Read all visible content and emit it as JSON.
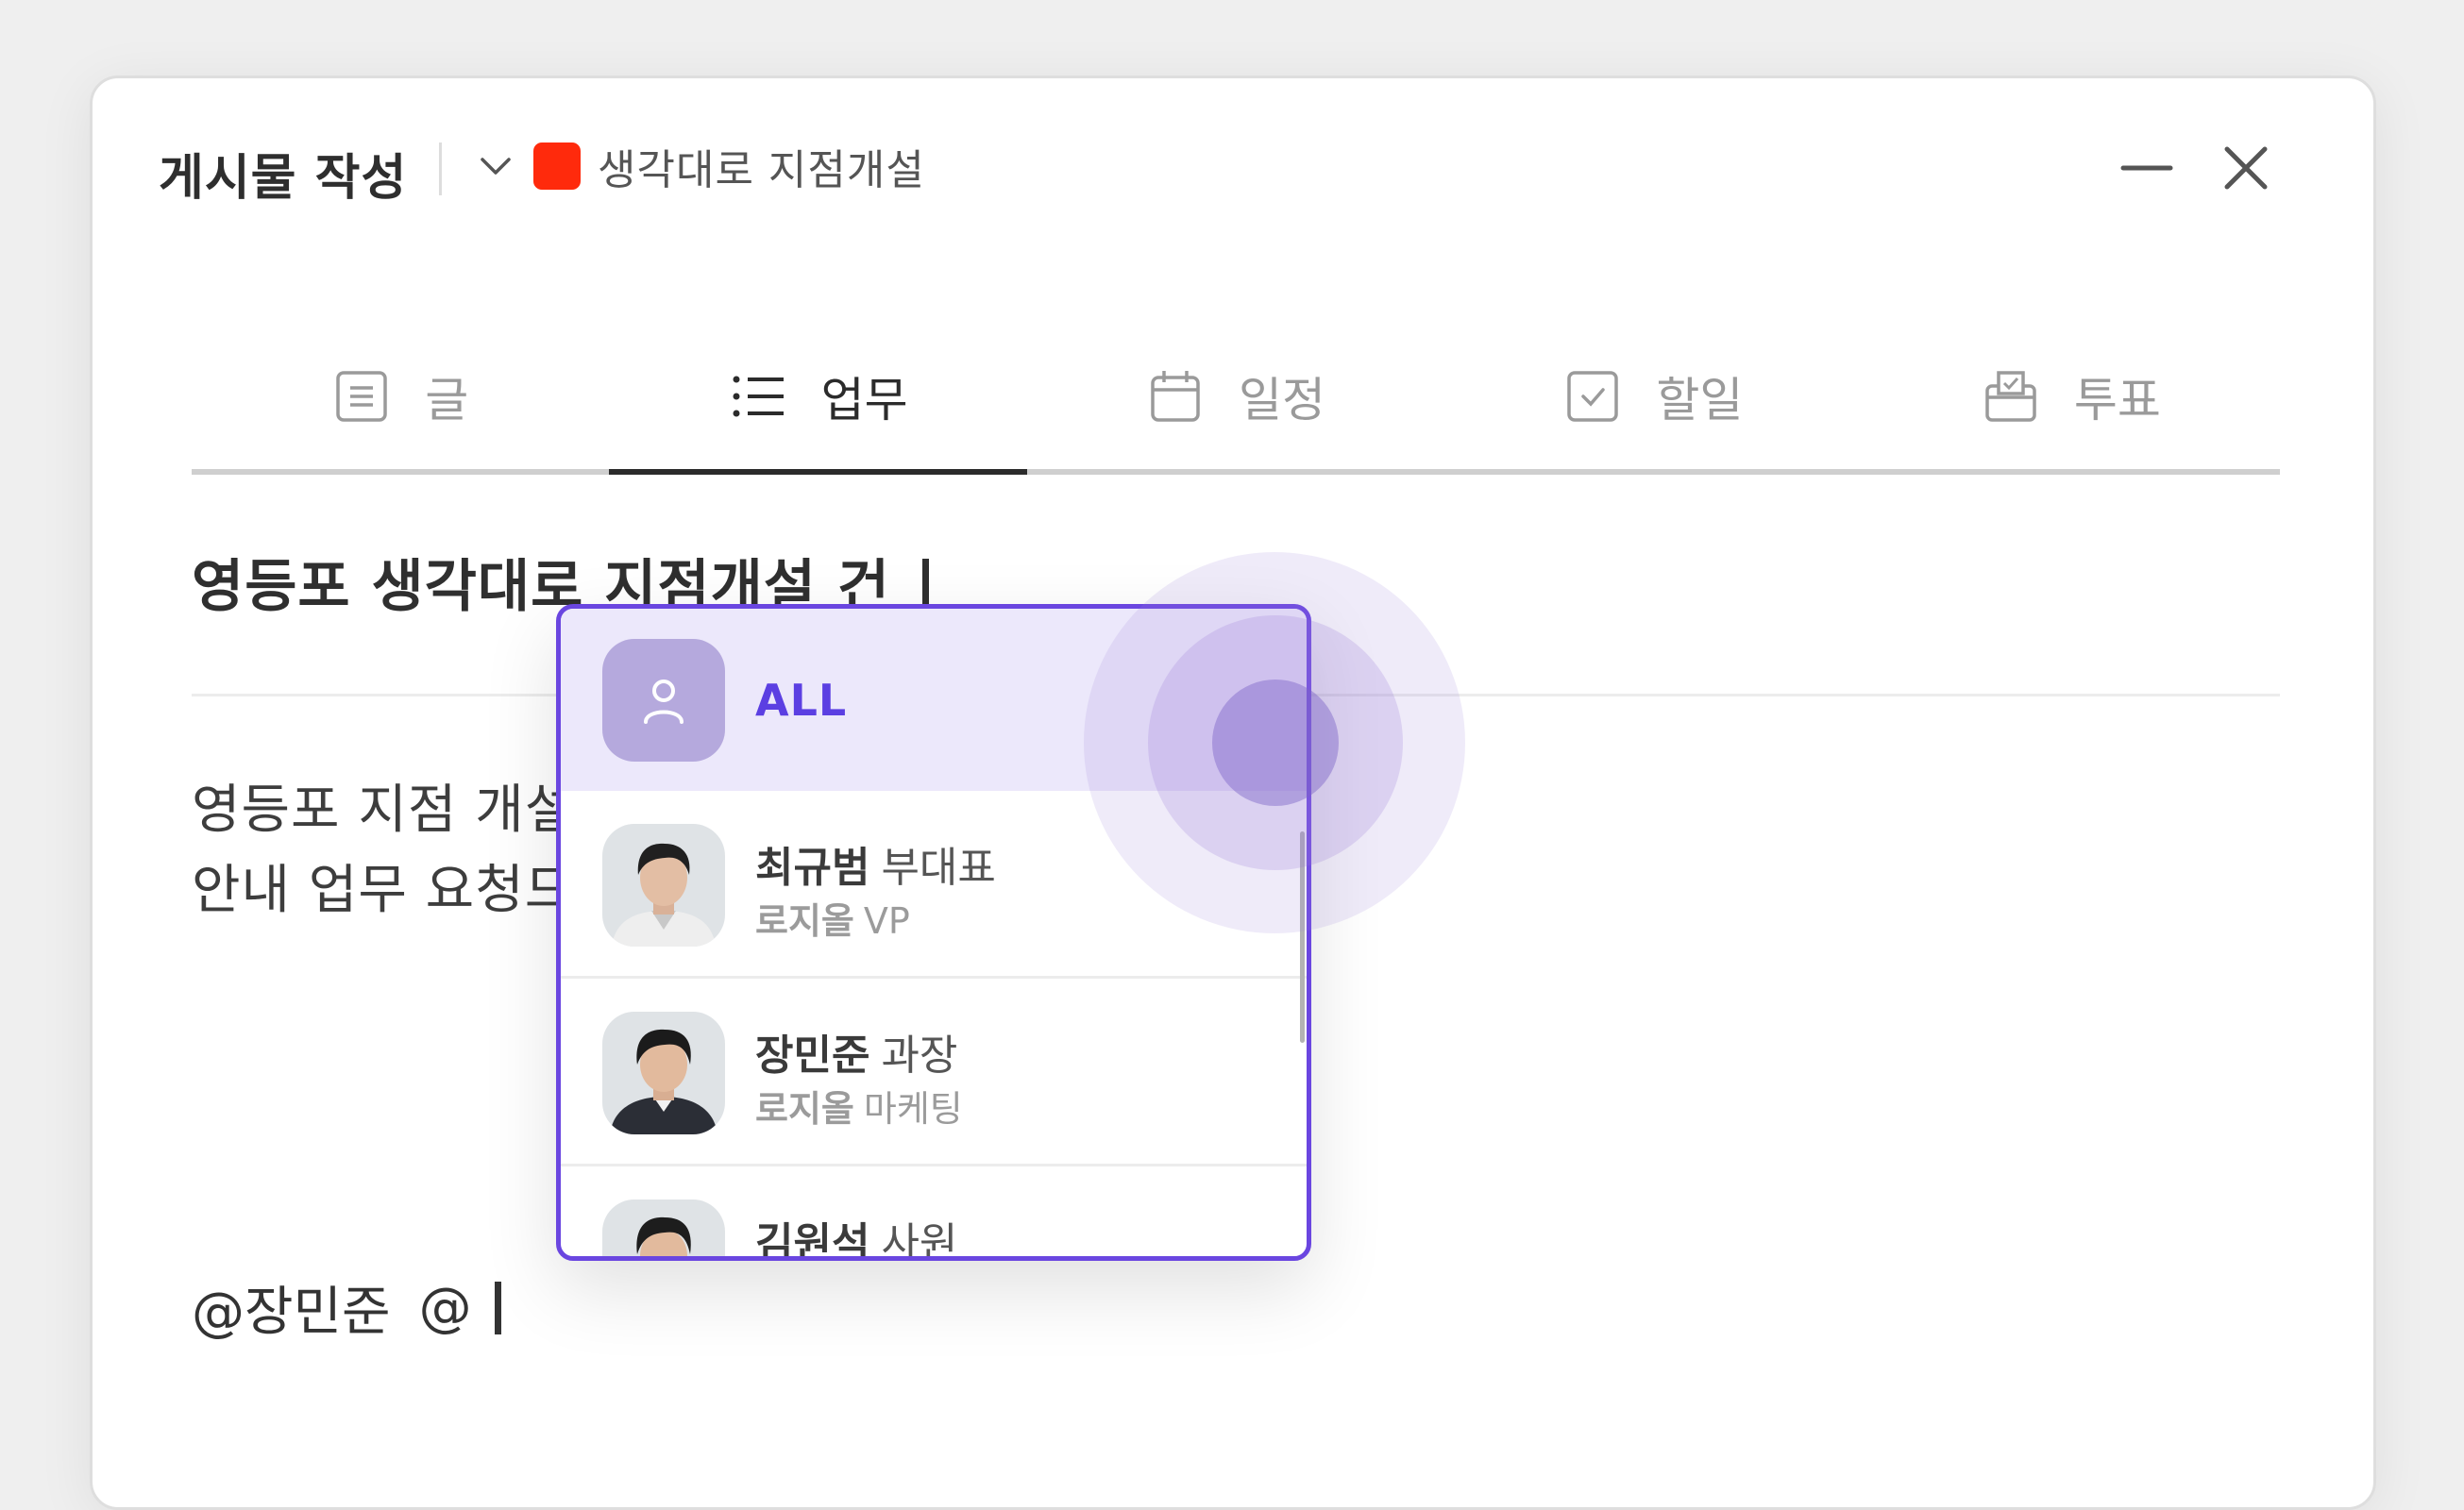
{
  "header": {
    "title": "게시물 작성",
    "group_name": "생각대로 지점개설",
    "group_color": "#ff2a0c"
  },
  "tabs": [
    {
      "label": "글",
      "icon": "document-icon"
    },
    {
      "label": "업무",
      "icon": "list-icon",
      "active": true
    },
    {
      "label": "일정",
      "icon": "calendar-icon"
    },
    {
      "label": "할일",
      "icon": "checkbox-icon"
    },
    {
      "label": "투표",
      "icon": "ballot-box-icon"
    }
  ],
  "editor": {
    "title": "영등포 생각대로 지점개설 건",
    "body_line_1": "영등포 지점 개설",
    "body_line_2": "안내 업무 요청드",
    "mention_text": "@장민준",
    "at_symbol": "@"
  },
  "mention_dropdown": {
    "accent": "#6a46e0",
    "all_label": "ALL",
    "people": [
      {
        "name": "최규범",
        "title": "부대표",
        "org": "로지올",
        "dept": "VP"
      },
      {
        "name": "장민준",
        "title": "과장",
        "org": "로지올",
        "dept": "마케팅"
      },
      {
        "name": "김원석",
        "title": "사원",
        "org": "",
        "dept": ""
      }
    ]
  }
}
